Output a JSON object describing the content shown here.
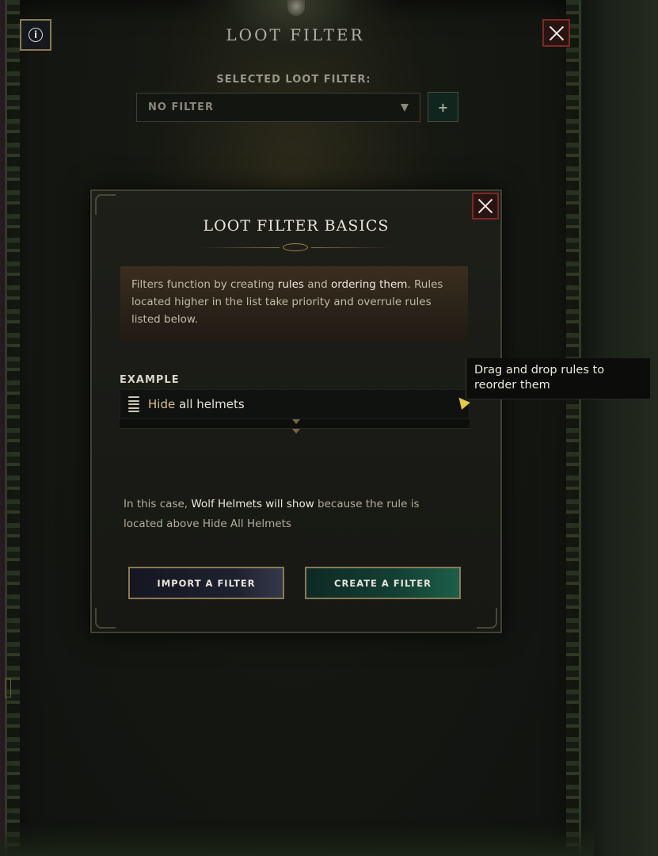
{
  "header": {
    "title": "LOOT FILTER",
    "info_icon": "info-icon",
    "info_glyph": "i",
    "close_icon": "close-icon"
  },
  "selector": {
    "label": "SELECTED LOOT FILTER:",
    "value": "NO FILTER",
    "dropdown_icon": "triangle-down-icon",
    "add_label": "+"
  },
  "modal": {
    "title": "LOOT FILTER BASICS",
    "close_icon": "close-icon",
    "description": {
      "part1": "Filters function by creating ",
      "rules": "rules",
      "part2": " and ",
      "ordering": "ordering them",
      "part3": ". Rules located higher in the list take priority and overrule rules listed below."
    },
    "example": {
      "label": "EXAMPLE",
      "rule_action": "Hide",
      "rule_rest": " all helmets",
      "grip_icon": "drag-handle-icon"
    },
    "tooltip": "Drag and drop rules to reorder them",
    "result": {
      "part1": "In this case, ",
      "highlight": "Wolf Helmets will show",
      "part2": " because the rule is located above Hide All Helmets"
    },
    "buttons": {
      "import": "IMPORT A FILTER",
      "create": "CREATE A FILTER"
    }
  },
  "colors": {
    "accent_gold": "#8a7a52",
    "close_red": "#7b2a22",
    "create_green": "#134034",
    "tooltip_pointer": "#e6c84a"
  }
}
